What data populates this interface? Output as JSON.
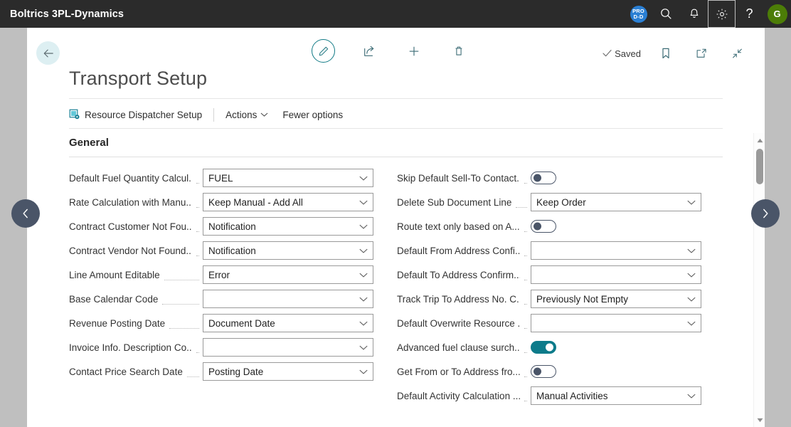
{
  "topbar": {
    "brand": "Boltrics 3PL-Dynamics",
    "pro_badge_line1": "PRO",
    "pro_badge_line2": "D-D",
    "search_icon": "search-icon",
    "notification_icon": "bell-icon",
    "settings_icon": "gear-icon",
    "help_label": "?",
    "avatar_initial": "G",
    "avatar_color": "#4c7d07",
    "badge_color": "#2a7fd4",
    "background": "#2b2b2b"
  },
  "commandbar": {
    "back_icon": "arrow-left-icon",
    "edit_icon": "pencil-icon",
    "share_icon": "share-icon",
    "new_icon": "plus-icon",
    "delete_icon": "trash-icon",
    "saved_label": "Saved",
    "saved_check_icon": "check-icon",
    "bookmark_icon": "bookmark-icon",
    "open-new-window_icon": "open-in-new-window-icon",
    "collapse_icon": "collapse-icon",
    "accent_color": "#127b86"
  },
  "page": {
    "title": "Transport Setup"
  },
  "ribbon": {
    "setup_icon": "resource-dispatcher-setup-icon",
    "setup_label": "Resource Dispatcher Setup",
    "actions_label": "Actions",
    "actions_chevron": "chevron-down-icon",
    "fewer_options_label": "Fewer options"
  },
  "section": {
    "title": "General"
  },
  "fields": {
    "left": [
      {
        "label": "Default Fuel Quantity Calcul...",
        "type": "dropdown",
        "value": "FUEL"
      },
      {
        "label": "Rate Calculation with Manu...",
        "type": "dropdown",
        "value": "Keep Manual - Add All"
      },
      {
        "label": "Contract Customer Not Fou...",
        "type": "dropdown",
        "value": "Notification"
      },
      {
        "label": "Contract Vendor Not Found...",
        "type": "dropdown",
        "value": "Notification"
      },
      {
        "label": "Line Amount Editable",
        "type": "dropdown",
        "value": "Error"
      },
      {
        "label": "Base Calendar Code",
        "type": "dropdown",
        "value": ""
      },
      {
        "label": "Revenue Posting Date",
        "type": "dropdown",
        "value": "Document Date"
      },
      {
        "label": "Invoice Info. Description Co...",
        "type": "dropdown",
        "value": ""
      },
      {
        "label": "Contact Price Search Date",
        "type": "dropdown",
        "value": "Posting Date"
      }
    ],
    "right": [
      {
        "label": "Skip Default Sell-To Contact...",
        "type": "toggle",
        "value": "off"
      },
      {
        "label": "Delete Sub Document Line",
        "type": "dropdown",
        "value": "Keep Order"
      },
      {
        "label": "Route text only based on A...",
        "type": "toggle",
        "value": "off"
      },
      {
        "label": "Default From Address Confi...",
        "type": "dropdown",
        "value": ""
      },
      {
        "label": "Default To Address Confirm...",
        "type": "dropdown",
        "value": ""
      },
      {
        "label": "Track Trip To Address No. C...",
        "type": "dropdown",
        "value": "Previously Not Empty"
      },
      {
        "label": "Default Overwrite Resource ...",
        "type": "dropdown",
        "value": ""
      },
      {
        "label": "Advanced fuel clause surch...",
        "type": "toggle",
        "value": "on"
      },
      {
        "label": "Get From or To Address fro...",
        "type": "toggle",
        "value": "off"
      },
      {
        "label": "Default Activity Calculation ...",
        "type": "dropdown",
        "value": "Manual Activities"
      }
    ]
  },
  "navigation": {
    "previous_icon": "chevron-left-icon",
    "next_icon": "chevron-right-icon"
  },
  "scrollbar": {
    "up_icon": "caret-up-icon",
    "down_icon": "caret-down-icon"
  }
}
